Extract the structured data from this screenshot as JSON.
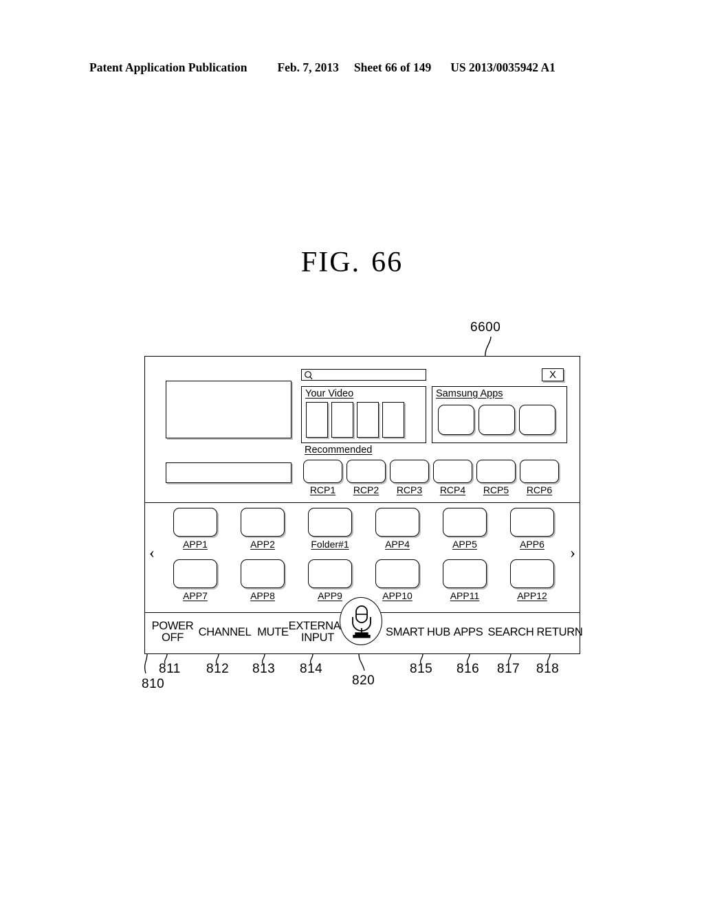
{
  "header": {
    "publication": "Patent Application Publication",
    "date": "Feb. 7, 2013",
    "sheet": "Sheet 66 of 149",
    "patent_number": "US 2013/0035942 A1"
  },
  "figure": {
    "label": "FIG.",
    "number": "66",
    "callout": "6600"
  },
  "screen": {
    "search": {
      "placeholder": "",
      "value": "",
      "icon": "search-icon"
    },
    "close_button": {
      "label": "X",
      "icon": "close-icon"
    },
    "your_video": {
      "title": "Your Video",
      "tiles": [
        "",
        "",
        "",
        ""
      ]
    },
    "samsung_apps": {
      "title": "Samsung Apps",
      "tiles": [
        "",
        "",
        ""
      ]
    },
    "recommended": {
      "title": "Recommended",
      "items": [
        "RCP1",
        "RCP2",
        "RCP3",
        "RCP4",
        "RCP5",
        "RCP6"
      ]
    },
    "app_grid": {
      "prev_arrow": "‹",
      "next_arrow": "›",
      "row1": [
        "APP1",
        "APP2",
        "Folder#1",
        "APP4",
        "APP5",
        "APP6"
      ],
      "row2": [
        "APP7",
        "APP8",
        "APP9",
        "APP10",
        "APP11",
        "APP12"
      ]
    },
    "toolbar": {
      "power_off": "POWER\nOFF",
      "power_off_line1": "POWER",
      "power_off_line2": "OFF",
      "channel": "CHANNEL",
      "mute": "MUTE",
      "external_input_line1": "EXTERNAL",
      "external_input_line2": "INPUT",
      "mic": "microphone-icon",
      "smart_hub": "SMART HUB",
      "apps": "APPS",
      "search": "SEARCH",
      "return": "RETURN"
    }
  },
  "reference_numbers": {
    "toolbar_group": "810",
    "power_off": "811",
    "channel": "812",
    "mute": "813",
    "external_input": "814",
    "smart_hub": "815",
    "apps": "816",
    "search": "817",
    "return": "818",
    "mic": "820"
  }
}
